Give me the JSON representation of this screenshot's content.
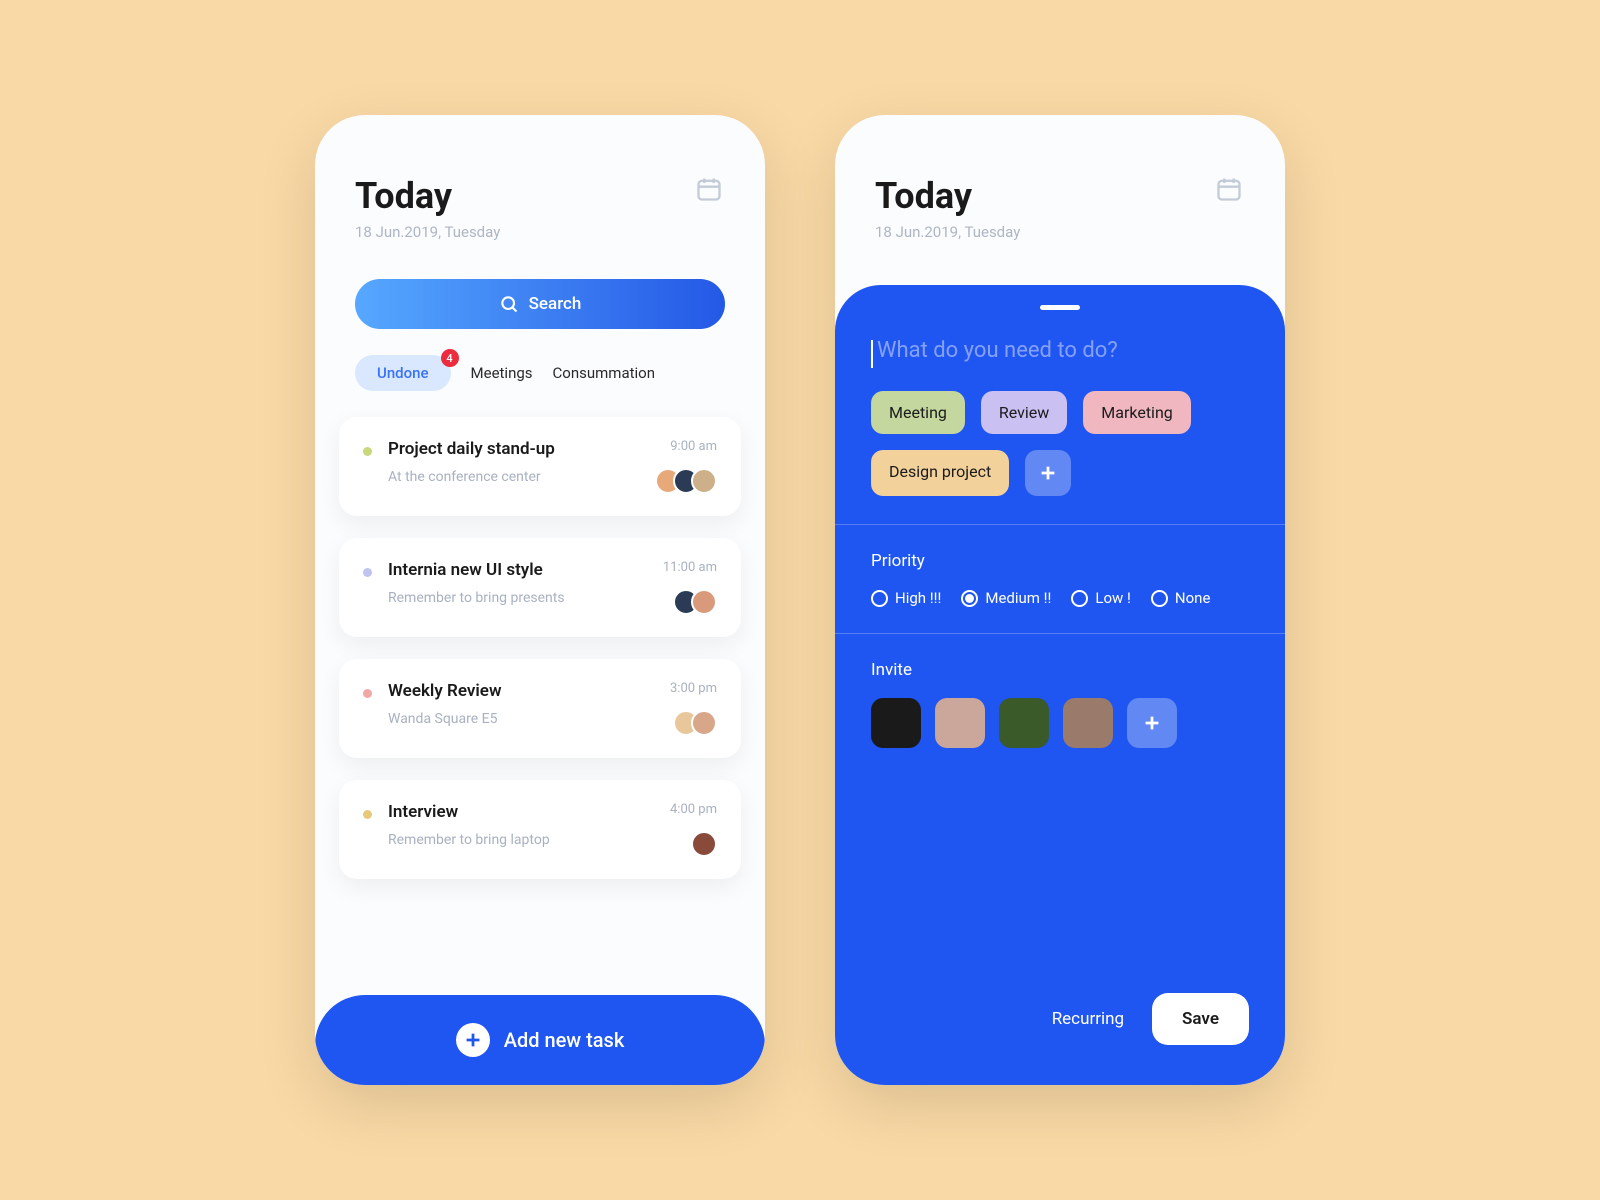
{
  "header": {
    "title": "Today",
    "date": "18 Jun.2019, Tuesday"
  },
  "search": {
    "label": "Search"
  },
  "tabs": {
    "items": [
      "Undone",
      "Meetings",
      "Consummation"
    ],
    "badge": "4"
  },
  "tasks": [
    {
      "title": "Project daily stand-up",
      "sub": "At the conference center",
      "time": "9:00 am",
      "dot": "#c8d87b",
      "avatars": [
        "#e8a97a",
        "#2b3b55",
        "#cdb08a"
      ]
    },
    {
      "title": "Internia new UI style",
      "sub": "Remember to bring presents",
      "time": "11:00 am",
      "dot": "#bfc3f2",
      "avatars": [
        "#2b3b55",
        "#d89a7a"
      ]
    },
    {
      "title": "Weekly Review",
      "sub": "Wanda Square E5",
      "time": "3:00 pm",
      "dot": "#f2a7a7",
      "avatars": [
        "#e8c79a",
        "#d8a78a"
      ]
    },
    {
      "title": "Interview",
      "sub": "Remember to bring laptop",
      "time": "4:00 pm",
      "dot": "#e8c87a",
      "avatars": [
        "#8a4a3a"
      ]
    }
  ],
  "addBtn": "Add new task",
  "sheet": {
    "placeholder": "What do you need to do?",
    "tags": [
      {
        "label": "Meeting",
        "color": "#c3d79e"
      },
      {
        "label": "Review",
        "color": "#cbc0f2"
      },
      {
        "label": "Marketing",
        "color": "#f0b7c1"
      },
      {
        "label": "Design project",
        "color": "#f2d19a"
      }
    ],
    "priority": {
      "title": "Priority",
      "options": [
        "High !!!",
        "Medium !!",
        "Low !",
        "None"
      ],
      "selected": 1
    },
    "invite": {
      "title": "Invite",
      "avatars": [
        "#1a1a1a",
        "#caa79a",
        "#3a5a2a",
        "#9a7a6a"
      ]
    },
    "recurring": "Recurring",
    "save": "Save"
  }
}
